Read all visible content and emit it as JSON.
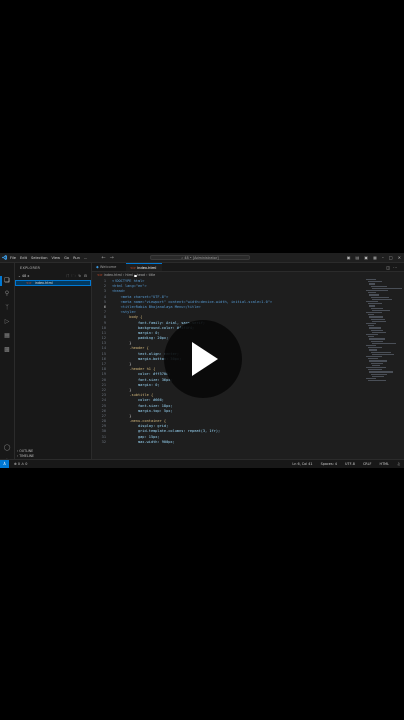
{
  "window": {
    "menu": [
      "File",
      "Edit",
      "Selection",
      "View",
      "Go",
      "Run",
      "..."
    ],
    "search": "⌕ 48 • [Administrator]"
  },
  "sidebar": {
    "header": "EXPLORER",
    "folder": "48 x",
    "file": "index.html",
    "outline": "OUTLINE",
    "timeline": "TIMELINE"
  },
  "tabs": [
    {
      "label": "Welcome"
    },
    {
      "label": "index.html"
    }
  ],
  "breadcrumb": [
    "index.html",
    "html",
    "head",
    "title"
  ],
  "code_lines": [
    {
      "n": "1",
      "text": "<!DOCTYPE html>"
    },
    {
      "n": "2",
      "text": "<html lang=\"en\">"
    },
    {
      "n": "3",
      "text": "<head>"
    },
    {
      "n": "4",
      "text": "    <meta charset=\"UTF-8\">"
    },
    {
      "n": "5",
      "text": "    <meta name=\"viewport\" content=\"width=device-width, initial-scale=1.0\">"
    },
    {
      "n": "6",
      "text": "    <title>Rabia Bhojanalaya Menu</title>"
    },
    {
      "n": "7",
      "text": "    <style>"
    },
    {
      "n": "8",
      "text": "        body {"
    },
    {
      "n": "9",
      "text": "            font-family: Arial, sans-serif;"
    },
    {
      "n": "10",
      "text": "            background-color: #f4f4f4;"
    },
    {
      "n": "11",
      "text": "            margin: 0;"
    },
    {
      "n": "12",
      "text": "            padding: 20px;"
    },
    {
      "n": "13",
      "text": "        }"
    },
    {
      "n": "14",
      "text": "        .header {"
    },
    {
      "n": "15",
      "text": "            text-align: center;"
    },
    {
      "n": "16",
      "text": "            margin-bottom: 30px;"
    },
    {
      "n": "17",
      "text": "        }"
    },
    {
      "n": "18",
      "text": "        .header h1 {"
    },
    {
      "n": "19",
      "text": "            color: #ff5700;"
    },
    {
      "n": "20",
      "text": "            font-size: 36px;"
    },
    {
      "n": "21",
      "text": "            margin: 0;"
    },
    {
      "n": "22",
      "text": "        }"
    },
    {
      "n": "23",
      "text": "        .subtitle {"
    },
    {
      "n": "24",
      "text": "            color: #666;"
    },
    {
      "n": "25",
      "text": "            font-size: 18px;"
    },
    {
      "n": "26",
      "text": "            margin-top: 5px;"
    },
    {
      "n": "27",
      "text": "        }"
    },
    {
      "n": "28",
      "text": "        .menu-container {"
    },
    {
      "n": "29",
      "text": "            display: grid;"
    },
    {
      "n": "30",
      "text": "            grid-template-columns: repeat(3, 1fr);"
    },
    {
      "n": "31",
      "text": "            gap: 15px;"
    },
    {
      "n": "32",
      "text": "            max-width: 900px;"
    }
  ],
  "status": {
    "left": "⊗ 0 ⚠ 0",
    "right": [
      "Ln 6, Col 41",
      "Spaces: 4",
      "UTF-8",
      "CRLF",
      "HTML"
    ]
  },
  "colors": {
    "accent": "#0078d4",
    "editor_bg": "#1e1e1e",
    "sidebar_bg": "#181818"
  },
  "icons": [
    "vscode-logo-icon",
    "files-icon",
    "search-icon",
    "source-control-icon",
    "run-debug-icon",
    "extensions-icon",
    "remote-icon",
    "account-icon",
    "gear-icon",
    "play-icon"
  ]
}
